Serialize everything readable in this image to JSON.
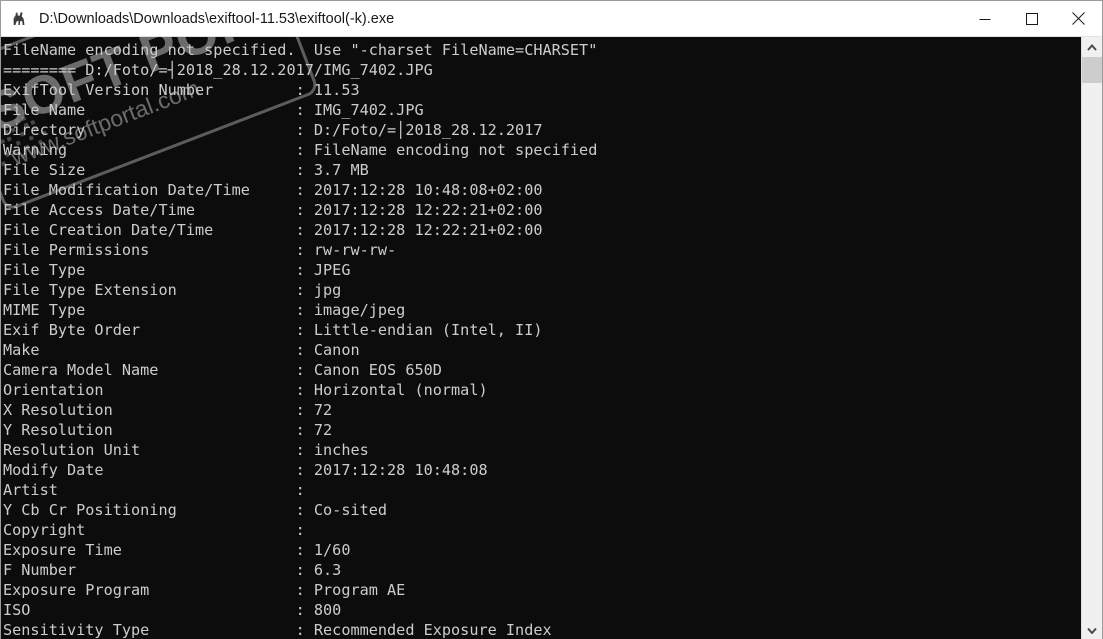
{
  "window": {
    "title": "D:\\Downloads\\Downloads\\exiftool-11.53\\exiftool(-k).exe",
    "app_icon": "camel-icon",
    "controls": {
      "minimize": "Minimize",
      "maximize": "Maximize",
      "close": "Close"
    },
    "colors": {
      "titlebar_bg": "#ffffff",
      "console_bg": "#0c0c0c",
      "console_fg": "#cccccc",
      "scrollbar_bg": "#f0f0f0",
      "scrollbar_thumb": "#cdcdcd"
    }
  },
  "watermark": {
    "main": "SOFT PORTAL",
    "sub": "www.softportal.com"
  },
  "scrollbar": {
    "up_arrow": "chevron-up-icon",
    "down_arrow": "chevron-down-icon",
    "thumb": "scrollbar-thumb"
  },
  "console": {
    "lines": [
      "FileName encoding not specified.  Use \"-charset FileName=CHARSET\"",
      "======== D:/Foto/=┤2018_28.12.2017/IMG_7402.JPG",
      "ExifTool Version Number         : 11.53",
      "File Name                       : IMG_7402.JPG",
      "Directory                       : D:/Foto/=│2018_28.12.2017",
      "Warning                         : FileName encoding not specified",
      "File Size                       : 3.7 MB",
      "File Modification Date/Time     : 2017:12:28 10:48:08+02:00",
      "File Access Date/Time           : 2017:12:28 12:22:21+02:00",
      "File Creation Date/Time         : 2017:12:28 12:22:21+02:00",
      "File Permissions                : rw-rw-rw-",
      "File Type                       : JPEG",
      "File Type Extension             : jpg",
      "MIME Type                       : image/jpeg",
      "Exif Byte Order                 : Little-endian (Intel, II)",
      "Make                            : Canon",
      "Camera Model Name               : Canon EOS 650D",
      "Orientation                     : Horizontal (normal)",
      "X Resolution                    : 72",
      "Y Resolution                    : 72",
      "Resolution Unit                 : inches",
      "Modify Date                     : 2017:12:28 10:48:08",
      "Artist                          :",
      "Y Cb Cr Positioning             : Co-sited",
      "Copyright                       :",
      "Exposure Time                   : 1/60",
      "F Number                        : 6.3",
      "Exposure Program                : Program AE",
      "ISO                             : 800",
      "Sensitivity Type                : Recommended Exposure Index"
    ]
  }
}
